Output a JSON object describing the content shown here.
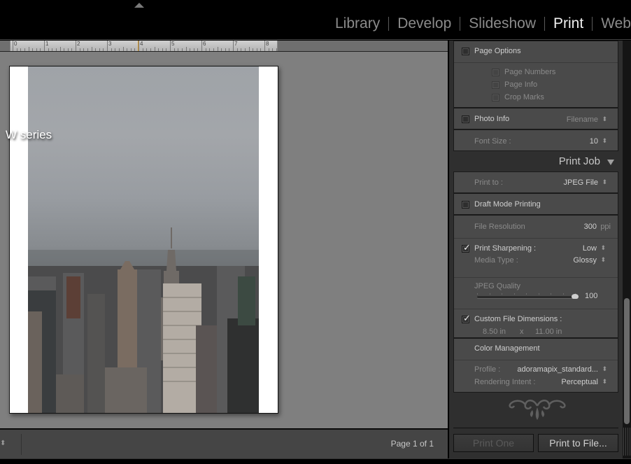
{
  "top_bar": {
    "collapse_icon": "triangle-up-icon",
    "modules": [
      {
        "label": "Library",
        "active": false
      },
      {
        "label": "Develop",
        "active": false
      },
      {
        "label": "Slideshow",
        "active": false
      },
      {
        "label": "Print",
        "active": true
      },
      {
        "label": "Web",
        "active": false
      }
    ]
  },
  "work_area": {
    "ruler": {
      "unit": "in",
      "labels": [
        "0",
        "1",
        "2",
        "3",
        "4",
        "5",
        "6",
        "7",
        "8"
      ],
      "cursor_position_in": 4.0
    },
    "overlay_text": "W series",
    "photo_subject": "Manhattan skyline with Empire State Building"
  },
  "bottom_bar": {
    "updown_icon": "updown-arrows-icon",
    "page_count": "Page 1 of 1"
  },
  "right_panel": {
    "page_options": {
      "label": "Page Options",
      "checked": false,
      "sub_options": [
        {
          "label": "Page Numbers",
          "checked": false
        },
        {
          "label": "Page Info",
          "checked": false
        },
        {
          "label": "Crop Marks",
          "checked": false
        }
      ]
    },
    "photo_info": {
      "label": "Photo Info",
      "checked": false,
      "value": "Filename"
    },
    "font_size": {
      "label": "Font Size :",
      "value": "10"
    },
    "print_job": {
      "title": "Print Job",
      "collapse_icon": "triangle-down-icon",
      "print_to": {
        "label": "Print to :",
        "value": "JPEG File"
      },
      "draft_mode": {
        "label": "Draft Mode Printing",
        "checked": false
      },
      "file_resolution": {
        "label": "File Resolution",
        "value": "300",
        "unit": "ppi"
      },
      "print_sharpening": {
        "label": "Print Sharpening :",
        "checked": true,
        "value": "Low"
      },
      "media_type": {
        "label": "Media Type :",
        "value": "Glossy"
      },
      "jpeg_quality": {
        "label": "JPEG Quality",
        "value": "100",
        "fraction": 1.0
      },
      "custom_file_dimensions": {
        "label": "Custom File Dimensions :",
        "checked": true,
        "width": "8.50 in",
        "separator": "x",
        "height": "11.00 in"
      },
      "color_management": {
        "label": "Color Management",
        "profile_label": "Profile :",
        "profile_value": "adoramapix_standard...",
        "intent_label": "Rendering Intent :",
        "intent_value": "Perceptual"
      }
    },
    "buttons": {
      "print_one": "Print One",
      "print_to_file": "Print to File..."
    }
  }
}
